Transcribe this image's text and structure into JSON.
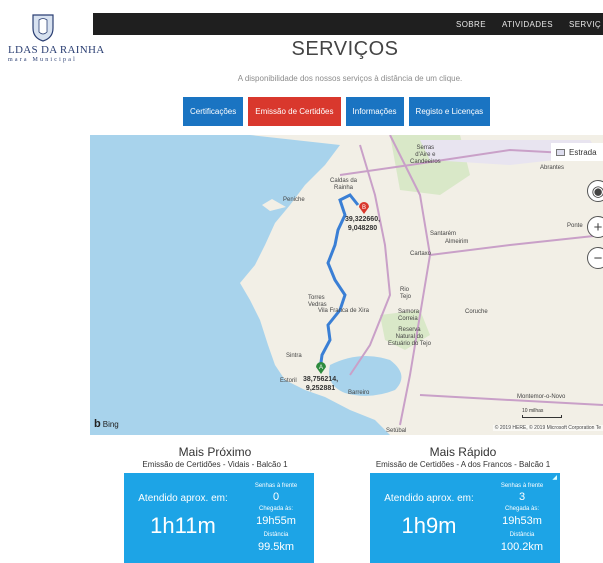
{
  "header": {
    "logo_name": "LDAS DA RAINHA",
    "logo_sub": "mara Municipal",
    "nav": [
      "SOBRE",
      "ATIVIDADES",
      "SERVIÇ"
    ]
  },
  "page": {
    "title": "SERVIÇOS",
    "subtitle": "A disponibilidade dos nossos serviços à distância de um clique."
  },
  "tabs": [
    {
      "label": "Certificações",
      "active": false
    },
    {
      "label": "Emissão de Certidões",
      "active": true
    },
    {
      "label": "Informações",
      "active": false
    },
    {
      "label": "Registo e Licenças",
      "active": false
    }
  ],
  "map": {
    "type_label": "Estrada",
    "places": {
      "serras": "Serras\nd'Aire e\nCandeeiros",
      "caldas": "Caldas da\nRainha",
      "peniche": "Peniche",
      "santarem": "Santarém",
      "almeirim": "Almeirim",
      "cartaxo": "Cartaxo",
      "torres": "Torres\nVedras",
      "rio_tejo": "Rio\nTejo",
      "vila_franca": "Vila Franca de Xira",
      "samora": "Samora\nCorreia",
      "coruche": "Coruche",
      "reserva": "Reserva\nNatural do\nEstuário do Tejo",
      "sintra": "Sintra",
      "estoril": "Estoril",
      "barreiro": "Barreiro",
      "setubal": "Setúbal",
      "montemor": "Montemor-o-Novo",
      "abrantes": "Abrantes",
      "ponte": "Ponte"
    },
    "start_coords": "38,756214,\n9,252881",
    "end_coords": "39,322660,\n9,048280",
    "start_marker": "A",
    "end_marker": "B",
    "bing_label": "Bing",
    "scale_label": "10 milhas",
    "copyright": "© 2019 HERE, © 2019 Microsoft Corporation  Te",
    "colors": {
      "route": "#3a7fd5",
      "water": "#a8d3ec",
      "land": "#f2efe6",
      "marker_start": "#2e8b3e",
      "marker_end": "#d9382d"
    }
  },
  "results": [
    {
      "heading": "Mais Próximo",
      "location": "Emissão de Certidões - Vidais - Balcão 1",
      "wait_label": "Atendido aprox. em:",
      "wait_time": "1h11m",
      "queue_label": "Senhas à frente",
      "queue": "0",
      "arrival_label": "Chegada às:",
      "arrival": "19h55m",
      "distance_label": "Distância",
      "distance": "99.5km"
    },
    {
      "heading": "Mais Rápido",
      "location": "Emissão de Certidões - A dos Francos - Balcão 1",
      "wait_label": "Atendido aprox. em:",
      "wait_time": "1h9m",
      "queue_label": "Senhas à frente",
      "queue": "3",
      "arrival_label": "Chegada às:",
      "arrival": "19h53m",
      "distance_label": "Distância",
      "distance": "100.2km"
    }
  ]
}
